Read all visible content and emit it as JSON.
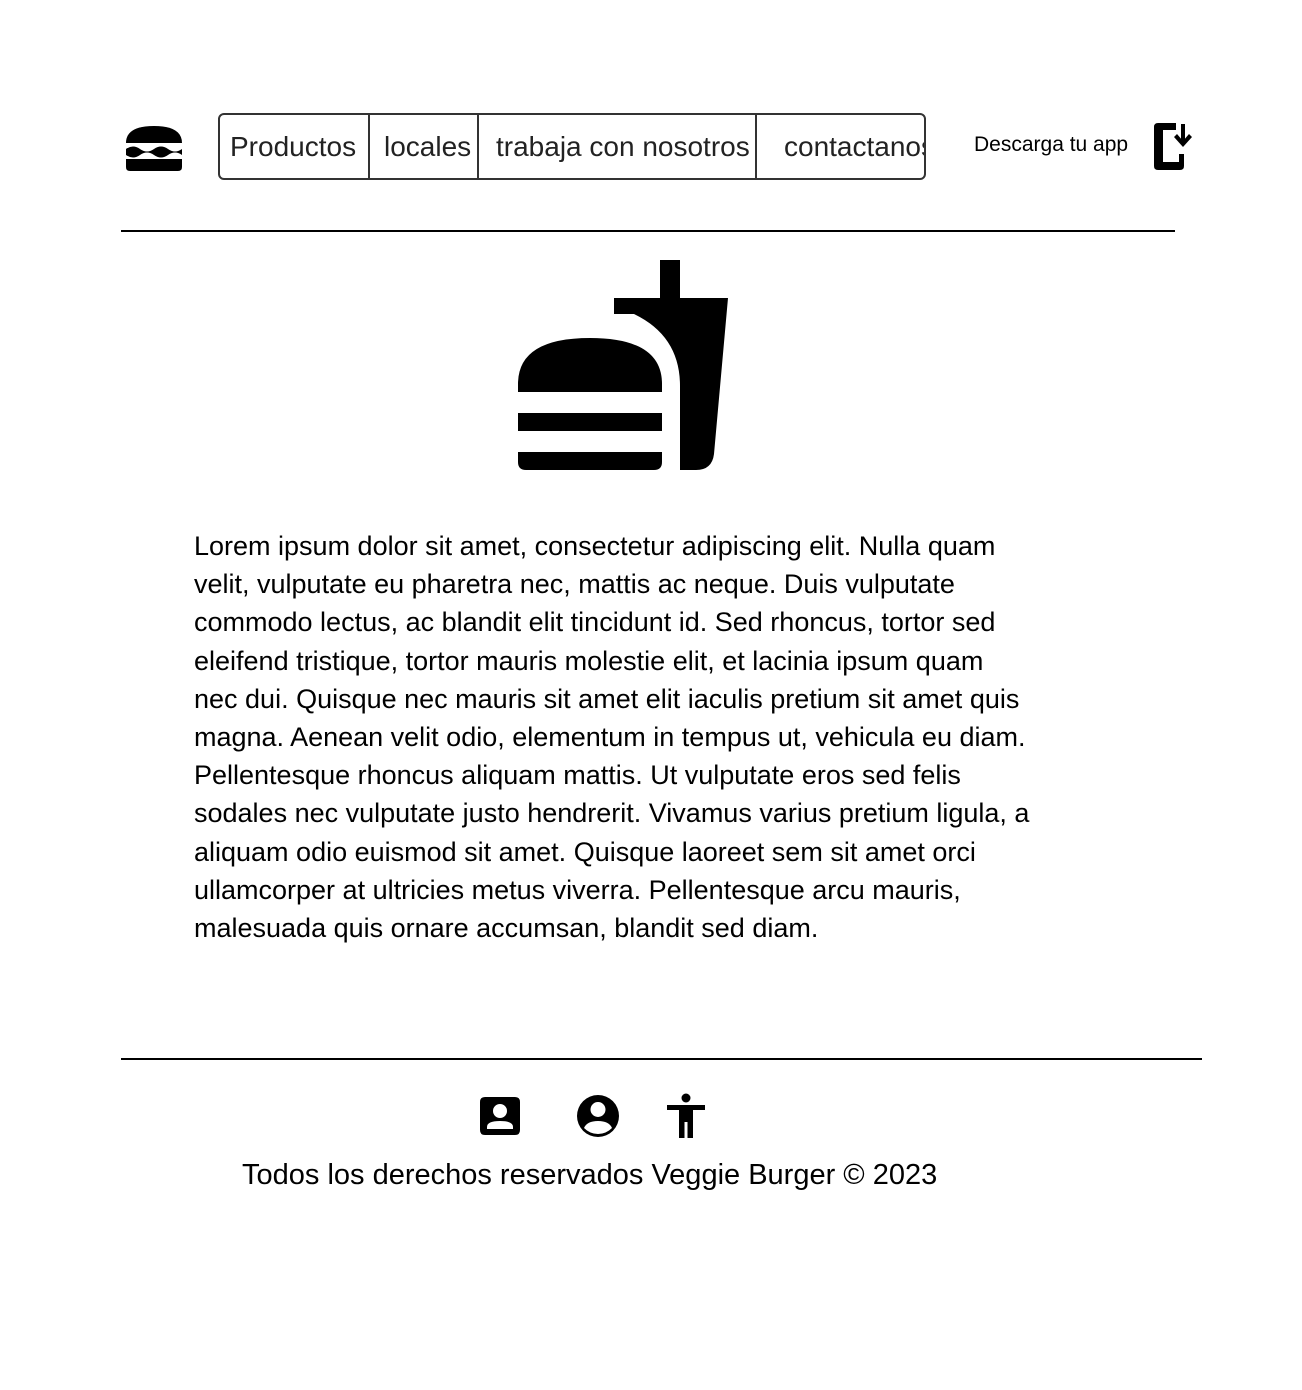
{
  "header": {
    "logo_icon": "burger-icon",
    "nav": [
      {
        "label": "Productos"
      },
      {
        "label": "locales"
      },
      {
        "label": "trabaja con nosotros"
      },
      {
        "label": "contactanos"
      }
    ],
    "download_label": "Descarga tu app",
    "download_icon": "phone-download-icon"
  },
  "main": {
    "hero_icon": "burger-and-drink-icon",
    "body": "Lorem ipsum dolor sit amet, consectetur adipiscing elit. Nulla quam velit, vulputate eu pharetra nec, mattis ac neque. Duis vulputate commodo lectus, ac blandit elit tincidunt id. Sed rhoncus, tortor sed eleifend tristique, tortor mauris molestie elit, et lacinia ipsum quam nec dui. Quisque nec mauris sit amet elit iaculis pretium sit amet quis magna. Aenean velit odio, elementum in tempus ut, vehicula eu diam. Pellentesque rhoncus aliquam mattis. Ut vulputate eros sed felis sodales nec vulputate justo hendrerit. Vivamus varius pretium ligula, a aliquam odio euismod sit amet. Quisque laoreet sem sit amet orci ullamcorper at ultricies metus viverra. Pellentesque arcu mauris, malesuada quis ornare accumsan, blandit sed diam."
  },
  "footer": {
    "icons": [
      "contact-card-icon",
      "account-circle-icon",
      "accessibility-icon"
    ],
    "copyright": "Todos los derechos reservados Veggie Burger © 2023"
  }
}
